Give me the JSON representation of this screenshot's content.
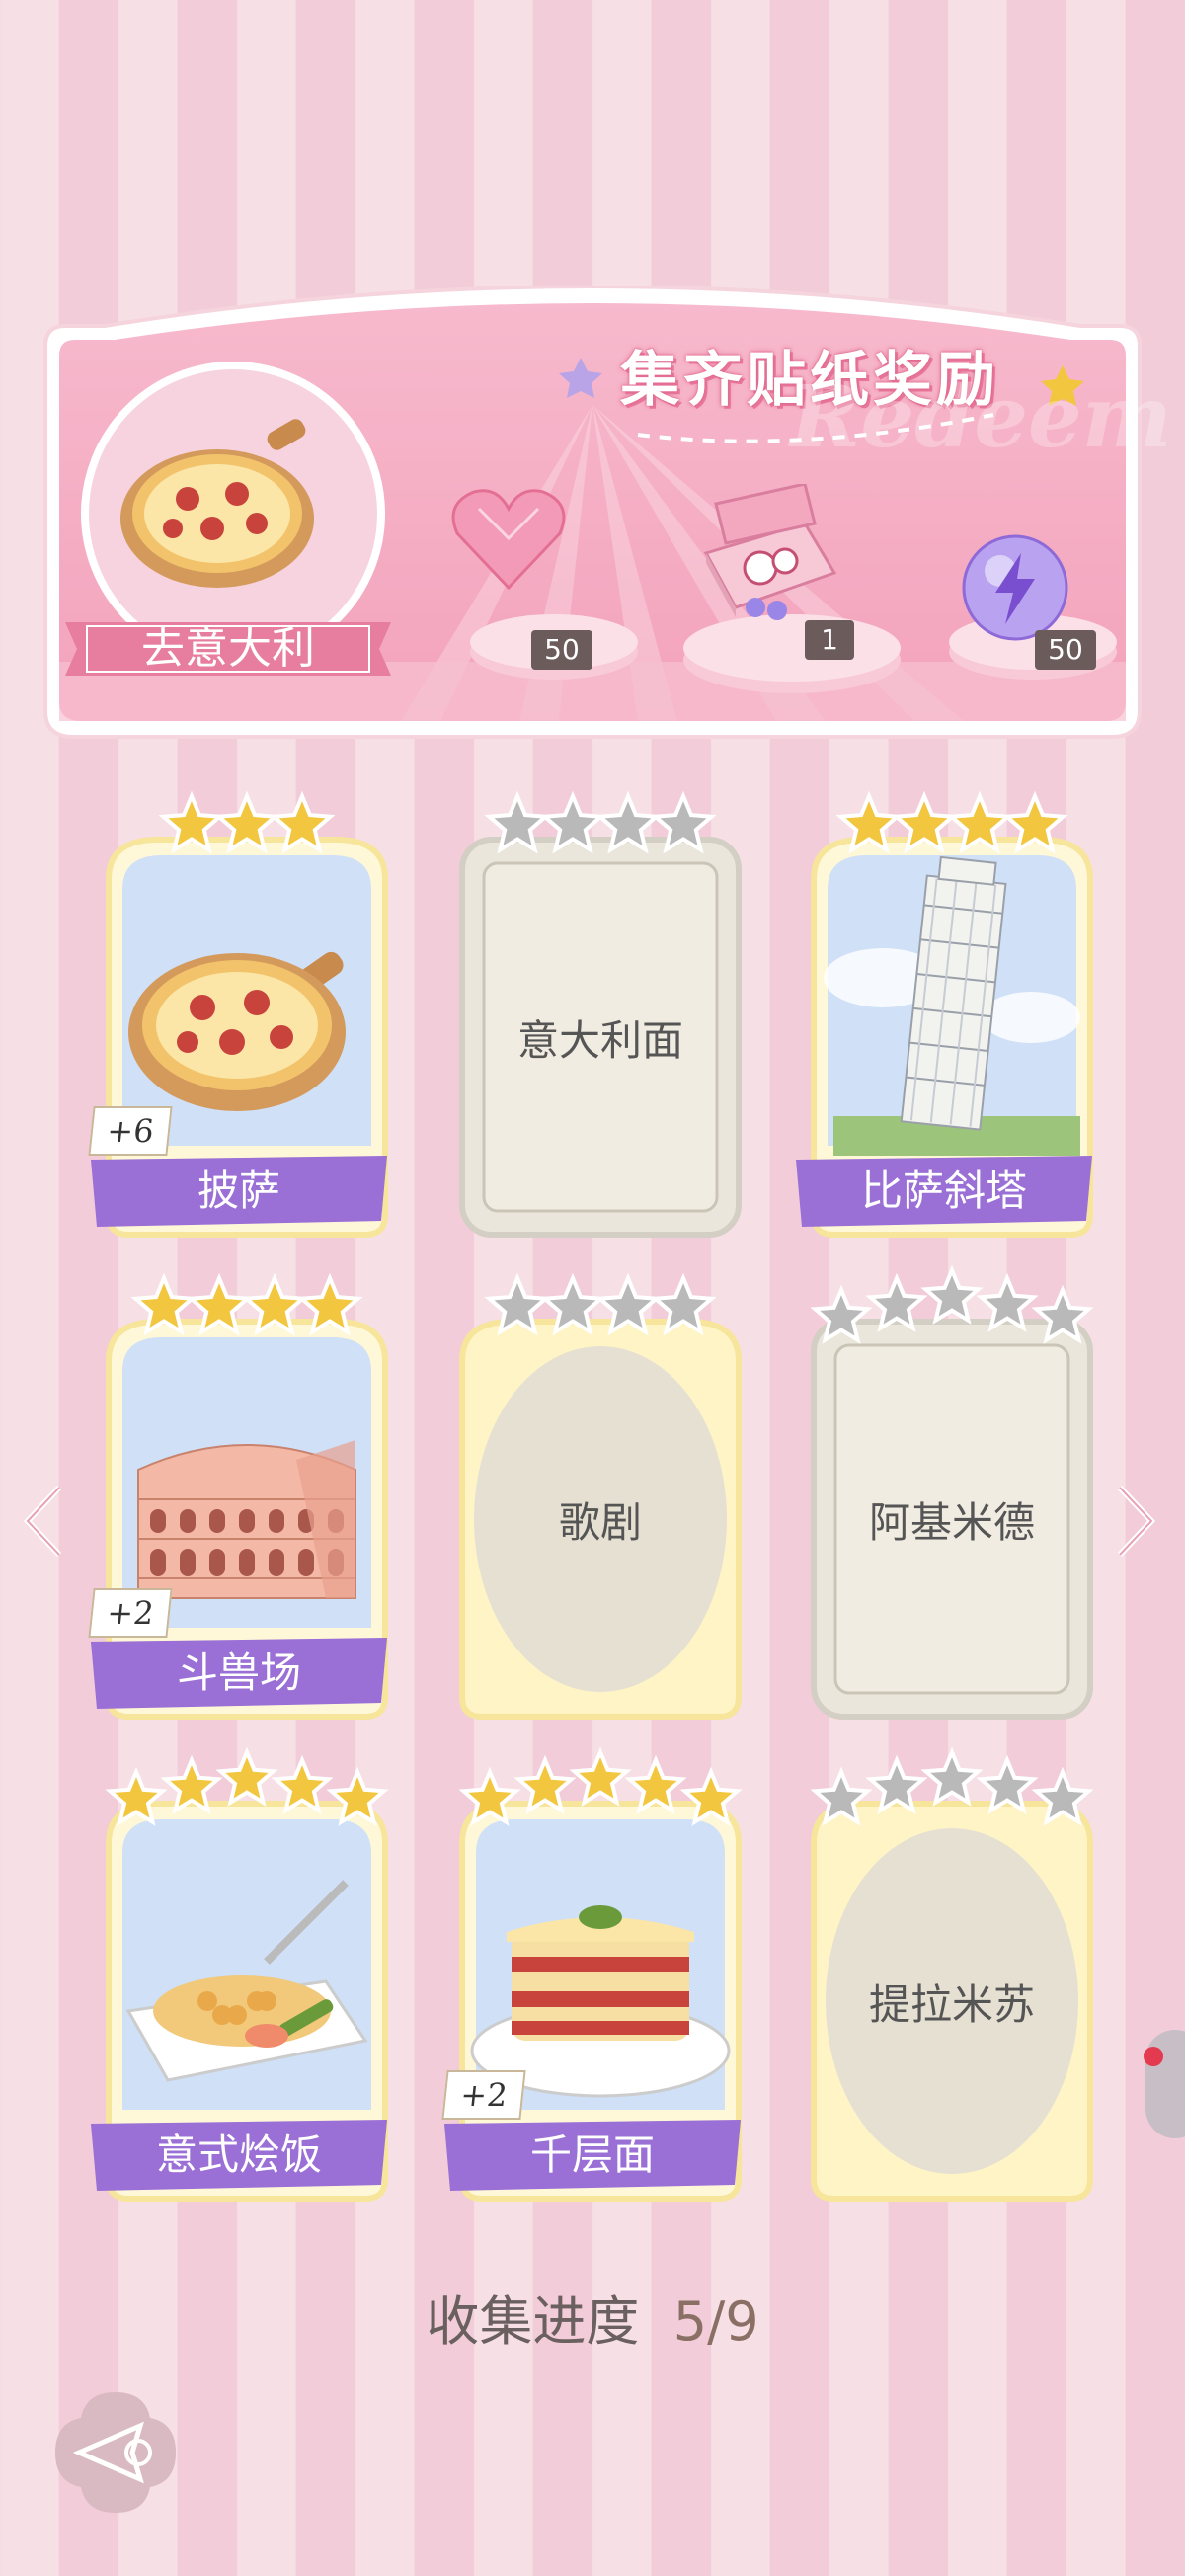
{
  "banner": {
    "title": "集齐贴纸奖励",
    "watermark": "Redeem",
    "country_label": "去意大利",
    "rewards": [
      {
        "icon": "pink-heart-gem-icon",
        "count": "50"
      },
      {
        "icon": "gift-box-icon",
        "count": "1"
      },
      {
        "icon": "lightning-orb-icon",
        "count": "50"
      }
    ]
  },
  "cards": [
    {
      "name": "披萨",
      "stars_filled": 3,
      "stars_total": 3,
      "collected": true,
      "plus": "+6",
      "icon": "pizza-icon"
    },
    {
      "name": "意大利面",
      "stars_filled": 0,
      "stars_total": 4,
      "collected": false,
      "plus": "",
      "icon": ""
    },
    {
      "name": "比萨斜塔",
      "stars_filled": 4,
      "stars_total": 4,
      "collected": true,
      "plus": "",
      "icon": "leaning-tower-icon"
    },
    {
      "name": "斗兽场",
      "stars_filled": 4,
      "stars_total": 4,
      "collected": true,
      "plus": "+2",
      "icon": "colosseum-icon"
    },
    {
      "name": "歌剧",
      "stars_filled": 0,
      "stars_total": 4,
      "collected": false,
      "plus": "",
      "icon": ""
    },
    {
      "name": "阿基米德",
      "stars_filled": 0,
      "stars_total": 5,
      "collected": false,
      "plus": "",
      "icon": ""
    },
    {
      "name": "意式烩饭",
      "stars_filled": 5,
      "stars_total": 5,
      "collected": true,
      "plus": "",
      "icon": "risotto-icon"
    },
    {
      "name": "千层面",
      "stars_filled": 5,
      "stars_total": 5,
      "collected": true,
      "plus": "+2",
      "icon": "lasagna-icon"
    },
    {
      "name": "提拉米苏",
      "stars_filled": 0,
      "stars_total": 5,
      "collected": false,
      "plus": "",
      "icon": ""
    }
  ],
  "progress": {
    "label": "收集进度",
    "value": "5/9"
  },
  "nav": {
    "prev": "chevron-left-icon",
    "next": "chevron-right-icon",
    "back": "back-arrow-icon"
  },
  "colors": {
    "accent_purple": "#9a6fd6",
    "star_gold": "#f3c63f",
    "star_gray": "#b9b9b9",
    "banner_pink": "#f3a9c0"
  }
}
